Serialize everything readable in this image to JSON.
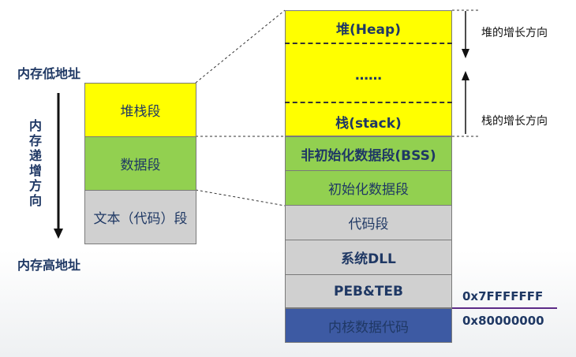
{
  "left": {
    "top_label": "内存低地址",
    "bottom_label": "内存高地址",
    "direction_label": "内存递增方向",
    "segments": [
      "堆栈段",
      "数据段",
      "文本（代码）段"
    ]
  },
  "right": {
    "heap_label": "堆(Heap)",
    "ellipsis": "……",
    "stack_label": "栈(stack)",
    "segments": [
      "非初始化数据段(BSS)",
      "初始化数据段",
      "代码段",
      "系统DLL",
      "PEB&TEB",
      "内核数据代码"
    ]
  },
  "annotations": {
    "heap_growth": "堆的增长方向",
    "stack_growth": "栈的增长方向",
    "addr_user_end": "0x7FFFFFFF",
    "addr_kernel_start": "0x80000000"
  },
  "colors": {
    "stack_heap": "#ffff00",
    "data": "#92d050",
    "code": "#d0d0d0",
    "kernel": "#3d5aa3",
    "divider": "#5b2a86"
  }
}
